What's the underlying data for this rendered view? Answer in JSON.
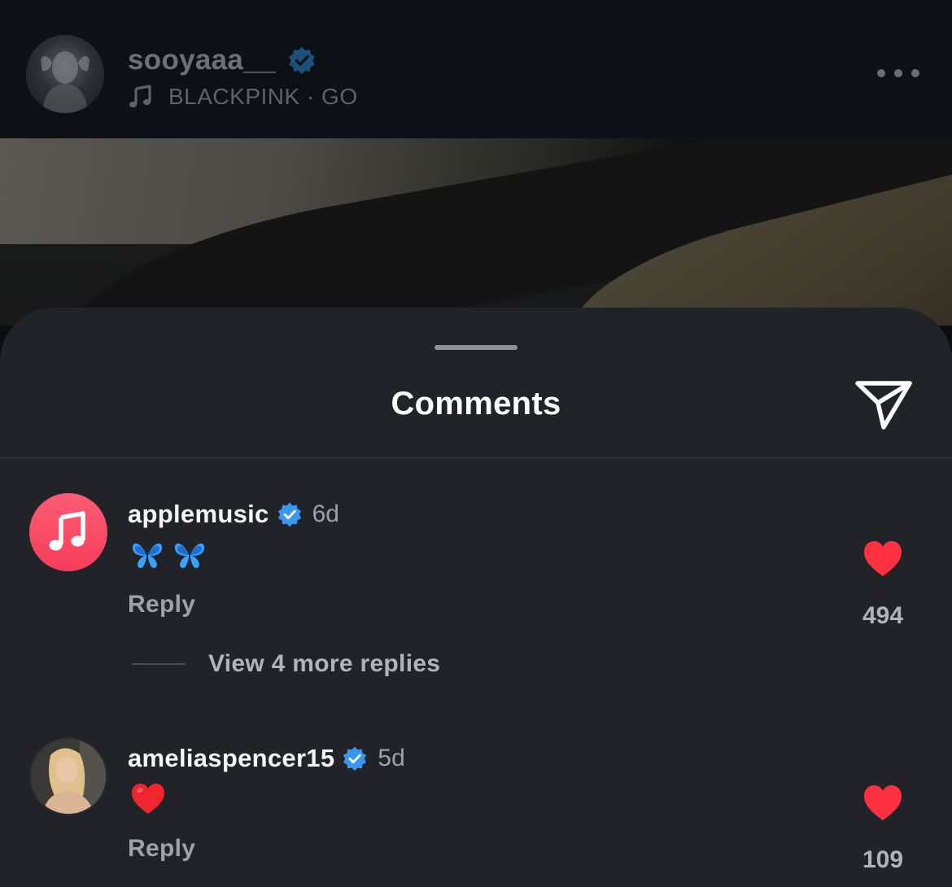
{
  "post": {
    "username": "sooyaaa__",
    "music": "BLACKPINK · GO"
  },
  "sheet": {
    "title": "Comments"
  },
  "comments": [
    {
      "username": "applemusic",
      "time": "6d",
      "body": "🦋🦋",
      "reply_label": "Reply",
      "likes": "494",
      "more_replies": "View 4 more replies"
    },
    {
      "username": "ameliaspencer15",
      "time": "5d",
      "body": "❤️",
      "reply_label": "Reply",
      "likes": "109"
    }
  ],
  "colors": {
    "verified": "#3897f0",
    "like": "#ff3040",
    "sheet_bg": "#212329"
  },
  "icons": {
    "share": "send-icon",
    "more": "more-horizontal-icon",
    "like": "heart-filled-icon",
    "verified": "verified-badge-icon"
  }
}
